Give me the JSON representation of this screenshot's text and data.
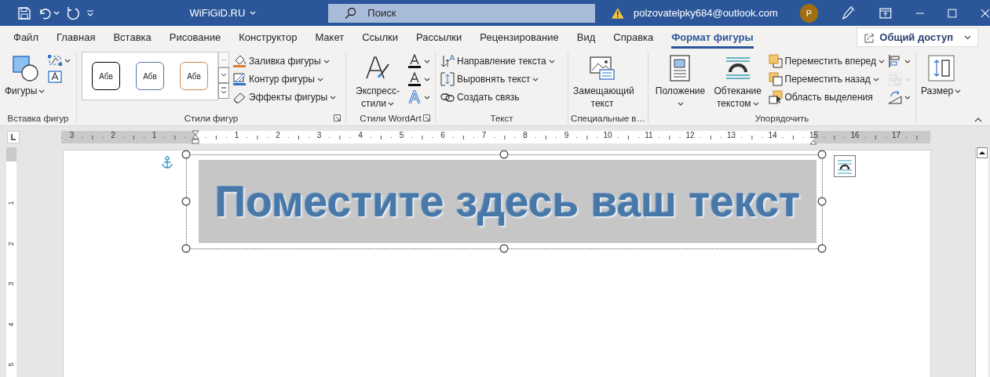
{
  "title_bar": {
    "document_title": "WiFiGiD.RU",
    "search": {
      "placeholder": "Поиск"
    },
    "account": "polzovatelpky684@outlook.com",
    "avatar": "P"
  },
  "tabs": [
    {
      "label": "Файл",
      "selected": false
    },
    {
      "label": "Главная",
      "selected": false
    },
    {
      "label": "Вставка",
      "selected": false
    },
    {
      "label": "Рисование",
      "selected": false
    },
    {
      "label": "Конструктор",
      "selected": false
    },
    {
      "label": "Макет",
      "selected": false
    },
    {
      "label": "Ссылки",
      "selected": false
    },
    {
      "label": "Рассылки",
      "selected": false
    },
    {
      "label": "Рецензирование",
      "selected": false
    },
    {
      "label": "Вид",
      "selected": false
    },
    {
      "label": "Справка",
      "selected": false
    },
    {
      "label": "Формат фигуры",
      "selected": true
    }
  ],
  "share_button": "Общий доступ",
  "ribbon": {
    "groups": [
      {
        "label": "Вставка фигур",
        "launcher": false,
        "items": [
          {
            "kind": "large",
            "label": "Фигуры",
            "caret": true
          },
          {
            "kind": "icons",
            "buttons": [
              {
                "caret": true,
                "disabled": false
              },
              {
                "caret": false,
                "disabled": false
              }
            ]
          }
        ]
      },
      {
        "label": "Стили фигур",
        "launcher": true,
        "items": [
          {
            "kind": "gallery",
            "styles": [
              {
                "label": "Абв",
                "color": "#000000"
              },
              {
                "label": "Абв",
                "color": "#5574a8"
              },
              {
                "label": "Абв",
                "color": "#d4884a"
              }
            ]
          },
          {
            "kind": "list",
            "entries": [
              {
                "label": "Заливка фигуры",
                "caret": true
              },
              {
                "label": "Контур фигуры",
                "caret": true
              },
              {
                "label": "Эффекты фигуры",
                "caret": true
              }
            ]
          }
        ]
      },
      {
        "label": "Стили WordArt",
        "launcher": true,
        "items": [
          {
            "kind": "large",
            "label": "Экспресс-стили",
            "caret": true
          },
          {
            "kind": "icons",
            "buttons": [
              {
                "caret": true,
                "disabled": false
              },
              {
                "caret": true,
                "disabled": false
              },
              {
                "caret": true,
                "disabled": false
              }
            ]
          }
        ]
      },
      {
        "label": "Текст",
        "launcher": false,
        "items": [
          {
            "kind": "list",
            "entries": [
              {
                "label": "Направление текста",
                "caret": true
              },
              {
                "label": "Выровнять текст",
                "caret": true
              },
              {
                "label": "Создать связь",
                "caret": false
              }
            ]
          }
        ]
      },
      {
        "label": "Специальные в…",
        "launcher": false,
        "items": [
          {
            "kind": "large",
            "label": "Замещающий текст",
            "caret": false
          }
        ]
      },
      {
        "label": "Упорядочить",
        "launcher": false,
        "items": [
          {
            "kind": "large",
            "label": "Положение",
            "caret": true
          },
          {
            "kind": "large",
            "label": "Обтекание текстом",
            "caret": true
          },
          {
            "kind": "list",
            "entries": [
              {
                "label": "Переместить вперед",
                "caret": true
              },
              {
                "label": "Переместить назад",
                "caret": true
              },
              {
                "label": "Область выделения",
                "caret": false
              }
            ]
          },
          {
            "kind": "icons",
            "buttons": [
              {
                "caret": true,
                "disabled": false
              },
              {
                "caret": true,
                "disabled": true
              },
              {
                "caret": true,
                "disabled": false
              }
            ]
          }
        ]
      },
      {
        "launcher": false,
        "items": [
          {
            "kind": "large",
            "label": "Размер",
            "caret": true
          }
        ]
      }
    ]
  },
  "ruler": {
    "labels": [
      "3",
      "2",
      "1",
      "1",
      "2",
      "3",
      "4",
      "5",
      "6",
      "7",
      "8",
      "9",
      "10",
      "11",
      "12",
      "13",
      "14",
      "15",
      "16",
      "17"
    ]
  },
  "vertical_ruler": {
    "labels": [
      "1",
      "2",
      "3",
      "4",
      "5"
    ]
  },
  "document": {
    "wordart_text": "Поместите здесь ваш текст"
  }
}
